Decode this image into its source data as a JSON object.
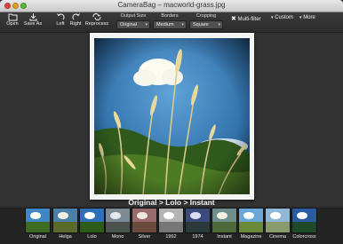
{
  "window": {
    "title": "CameraBag – macworld-grass.jpg"
  },
  "toolbar": {
    "open_label": "Open",
    "save_as_label": "Save As",
    "left_label": "Left",
    "right_label": "Right",
    "reprocess_label": "Reprocess",
    "output_size": {
      "label": "Output Size",
      "value": "Original"
    },
    "borders": {
      "label": "Borders",
      "value": "Medium"
    },
    "cropping": {
      "label": "Cropping",
      "value": "Square"
    },
    "multi_filter_label": "Multi-filter",
    "custom_label": "Custom",
    "more_label": "More"
  },
  "caption": "Original > Lolo > Instant",
  "filters": [
    {
      "name": "Original"
    },
    {
      "name": "Helga"
    },
    {
      "name": "Lolo"
    },
    {
      "name": "Mono"
    },
    {
      "name": "Silver"
    },
    {
      "name": "1962"
    },
    {
      "name": "1974"
    },
    {
      "name": "Instant"
    },
    {
      "name": "Magazine"
    },
    {
      "name": "Cinema"
    },
    {
      "name": "Colorcross"
    }
  ],
  "colors": {
    "window_bg": "#2e2e2e",
    "sky": "#3f86c4",
    "grass": "#3e6a22",
    "frame": "#f4f4f2"
  }
}
